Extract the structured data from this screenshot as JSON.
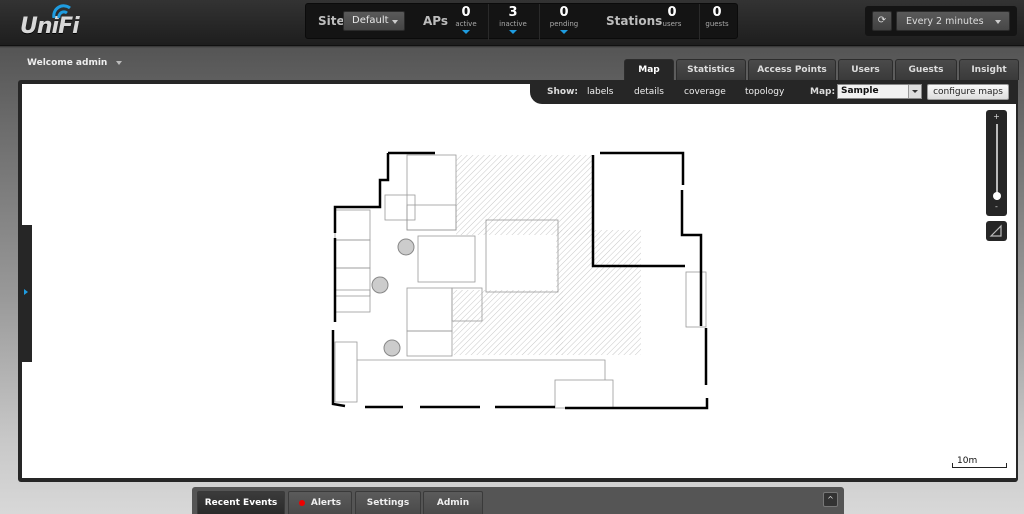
{
  "app": {
    "logo_text": "UniFi",
    "welcome": "Welcome admin"
  },
  "stats": {
    "site_label": "Site",
    "site_value": "Default",
    "aps_label": "APs",
    "aps": [
      {
        "value": "0",
        "label": "active"
      },
      {
        "value": "3",
        "label": "inactive"
      },
      {
        "value": "0",
        "label": "pending"
      }
    ],
    "stations_label": "Stations",
    "stations": [
      {
        "value": "0",
        "label": "users"
      },
      {
        "value": "0",
        "label": "guests"
      }
    ]
  },
  "refresh": {
    "icon": "refresh-icon",
    "interval": "Every 2 minutes"
  },
  "tabs": [
    {
      "label": "Map",
      "active": true
    },
    {
      "label": "Statistics"
    },
    {
      "label": "Access Points"
    },
    {
      "label": "Users"
    },
    {
      "label": "Guests"
    },
    {
      "label": "Insight"
    }
  ],
  "showbar": {
    "show_label": "Show:",
    "links": [
      "labels",
      "details",
      "coverage",
      "topology"
    ],
    "map_label": "Map:",
    "map_value": "Sample",
    "configure_label": "configure maps"
  },
  "zoom": {
    "plus": "+",
    "minus": "-",
    "level": 0.1
  },
  "scale": {
    "label": "10m"
  },
  "bottom_tabs": [
    {
      "label": "Recent Events",
      "active": true
    },
    {
      "label": "Alerts",
      "indicator_color": "#e00000"
    },
    {
      "label": "Settings"
    },
    {
      "label": "Admin"
    }
  ],
  "collapse_label": "^",
  "colors": {
    "accent": "#1e9ce0",
    "alert": "#e00000"
  }
}
